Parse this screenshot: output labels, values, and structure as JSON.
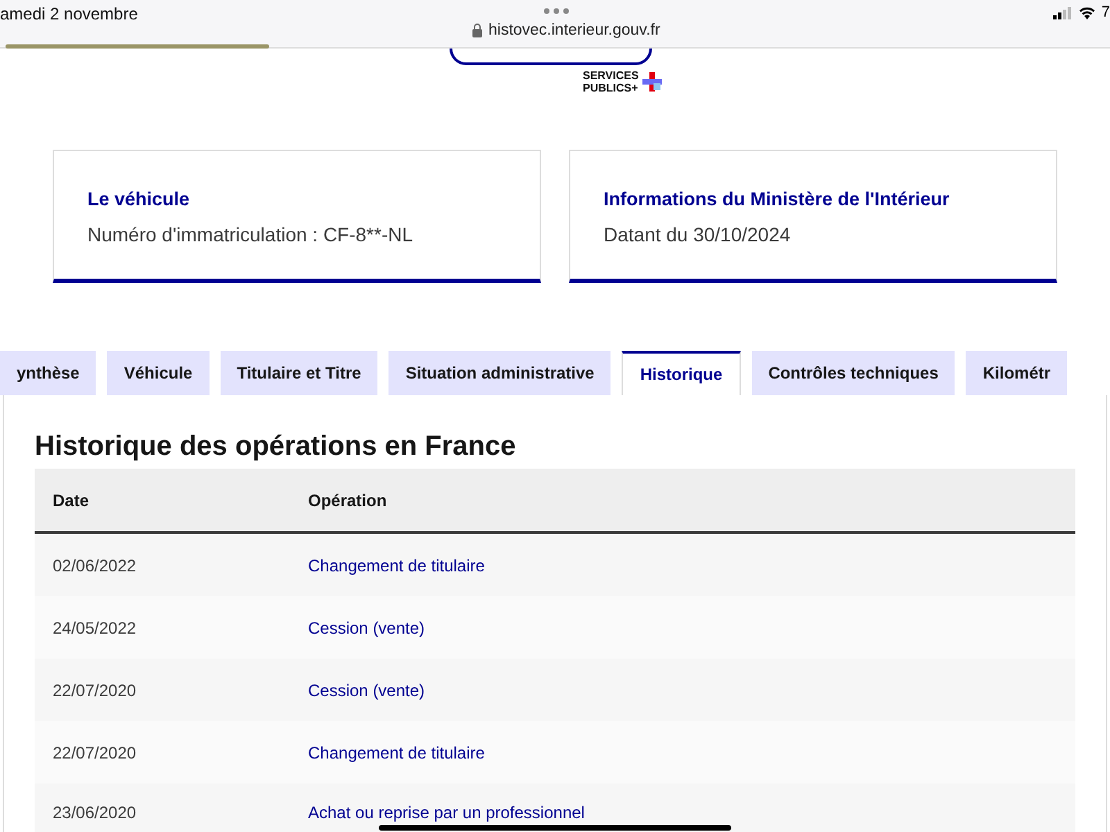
{
  "status_bar": {
    "date": "amedi 2 novembre",
    "url": "histovec.interieur.gouv.fr",
    "battery": "7"
  },
  "header": {
    "logo_text": [
      "SERVICES",
      "PUBLICS+"
    ]
  },
  "cards": [
    {
      "title": "Le véhicule",
      "text": "Numéro d'immatriculation : CF-8**-NL"
    },
    {
      "title": "Informations du Ministère de l'Intérieur",
      "text": "Datant du 30/10/2024"
    }
  ],
  "tabs": [
    {
      "label": "ynthèse",
      "selected": false
    },
    {
      "label": "Véhicule",
      "selected": false
    },
    {
      "label": "Titulaire et Titre",
      "selected": false
    },
    {
      "label": "Situation administrative",
      "selected": false
    },
    {
      "label": "Historique",
      "selected": true
    },
    {
      "label": "Contrôles techniques",
      "selected": false
    },
    {
      "label": "Kilométr",
      "selected": false
    }
  ],
  "section": {
    "title": "Historique des opérations en France",
    "table": {
      "columns": [
        "Date",
        "Opération"
      ],
      "rows": [
        [
          "02/06/2022",
          "Changement de titulaire"
        ],
        [
          "24/05/2022",
          "Cession (vente)"
        ],
        [
          "22/07/2020",
          "Cession (vente)"
        ],
        [
          "22/07/2020",
          "Changement de titulaire"
        ],
        [
          "23/06/2020",
          "Achat ou reprise par un professionnel"
        ]
      ]
    }
  }
}
